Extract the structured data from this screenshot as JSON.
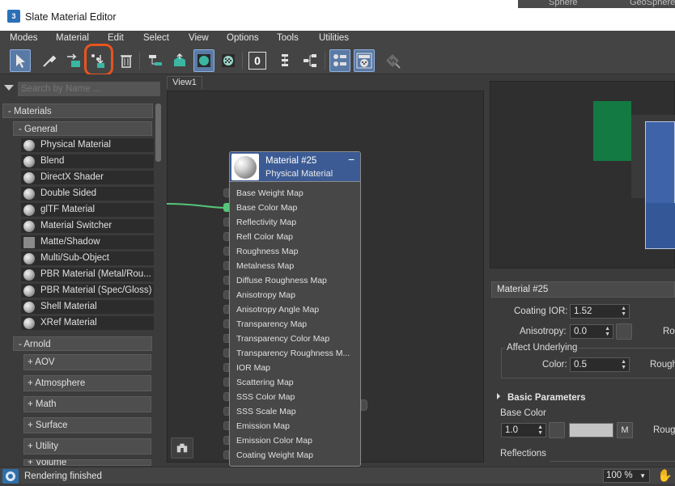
{
  "window": {
    "title": "Slate Material Editor",
    "app_icon_text": "3"
  },
  "top_tabs": [
    "Sphere",
    "GeoSphere"
  ],
  "menu": [
    "Modes",
    "Material",
    "Edit",
    "Select",
    "View",
    "Options",
    "Tools",
    "Utilities"
  ],
  "toolbar": {
    "icons": [
      "select-arrow-icon",
      "eyedropper-icon",
      "pick-material-icon",
      "put-to-scene-icon",
      "assign-to-selection-icon",
      "delete-icon",
      "move-children-icon",
      "hide-unused-icon",
      "show-in-viewport-icon",
      "background-checker-icon",
      "material-id-icon",
      "layout-all-icon",
      "layout-children-icon",
      "show-map-icon",
      "show-background-icon",
      "show-end-result-icon"
    ],
    "material_id_value": "0",
    "highlight_color": "#e8541e"
  },
  "browser": {
    "search_placeholder": "Search by Name ...",
    "materials_rollout": "- Materials",
    "general_rollout": "- General",
    "general_items": [
      "Physical Material",
      "Blend",
      "DirectX Shader",
      "Double Sided",
      "glTF Material",
      "Material Switcher",
      "Matte/Shadow",
      "Multi/Sub-Object",
      "PBR Material (Metal/Rou...",
      "PBR Material (Spec/Gloss)",
      "Shell Material",
      "XRef Material"
    ],
    "arnold_rollout": "- Arnold",
    "arnold_items": [
      "+ AOV",
      "+ Atmosphere",
      "+ Math",
      "+ Surface",
      "+ Utility",
      "+ Volume"
    ]
  },
  "view": {
    "tab_label": "View1",
    "node": {
      "title": "Material #25",
      "subtitle": "Physical Material",
      "minimize": "−",
      "slots": [
        "Base Weight Map",
        "Base Color Map",
        "Reflectivity Map",
        "Refl Color Map",
        "Roughness Map",
        "Metalness Map",
        "Diffuse Roughness Map",
        "Anisotropy Map",
        "Anisotropy Angle Map",
        "Transparency Map",
        "Transparency Color Map",
        "Transparency Roughness M...",
        "IOR Map",
        "Scattering Map",
        "SSS Color Map",
        "SSS Scale Map",
        "Emission Map",
        "Emission Color Map",
        "Coating Weight Map"
      ],
      "connected_slot": "Base Color Map",
      "wire_color": "#56c47a"
    }
  },
  "preview_colors": {
    "green": "#137a44",
    "blue": "#3e63a8"
  },
  "params": {
    "header": "Material #25",
    "coating_ior_label": "Coating IOR:",
    "coating_ior_value": "1.52",
    "anisotropy_label": "Anisotropy:",
    "anisotropy_value": "0.0",
    "rot_label": "Rot",
    "affect_label": "Affect Underlying",
    "color_label": "Color:",
    "color_value": "0.5",
    "rough_label": "Rough",
    "basic_params_title": "Basic Parameters",
    "base_color_label": "Base Color",
    "base_color_value": "1.0",
    "m_button": "M",
    "roug_label": "Roug",
    "reflections_label": "Reflections"
  },
  "status": {
    "text": "Rendering finished",
    "zoom": "100 %"
  }
}
